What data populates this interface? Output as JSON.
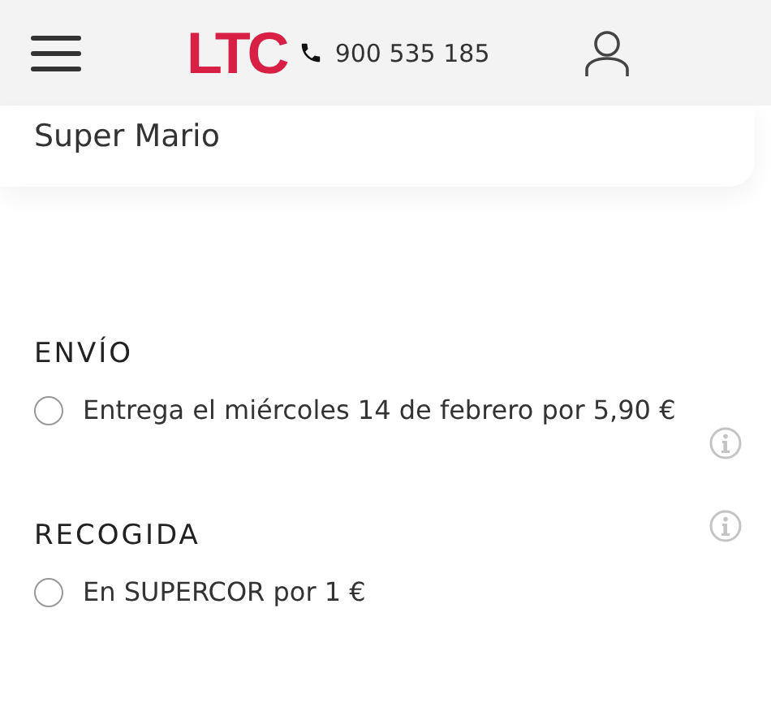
{
  "header": {
    "logo": "LTC",
    "phone": "900 535 185"
  },
  "product": {
    "name": "Super Mario"
  },
  "sections": [
    {
      "title": "ENVÍO",
      "title_info": false,
      "options": [
        {
          "label": "Entrega el miércoles 14 de febrero por 5,90 €",
          "selected": false,
          "info": true
        }
      ]
    },
    {
      "title": "RECOGIDA",
      "title_info": true,
      "options": [
        {
          "label": "En SUPERCOR por 1 €",
          "selected": false,
          "info": false
        }
      ]
    }
  ]
}
